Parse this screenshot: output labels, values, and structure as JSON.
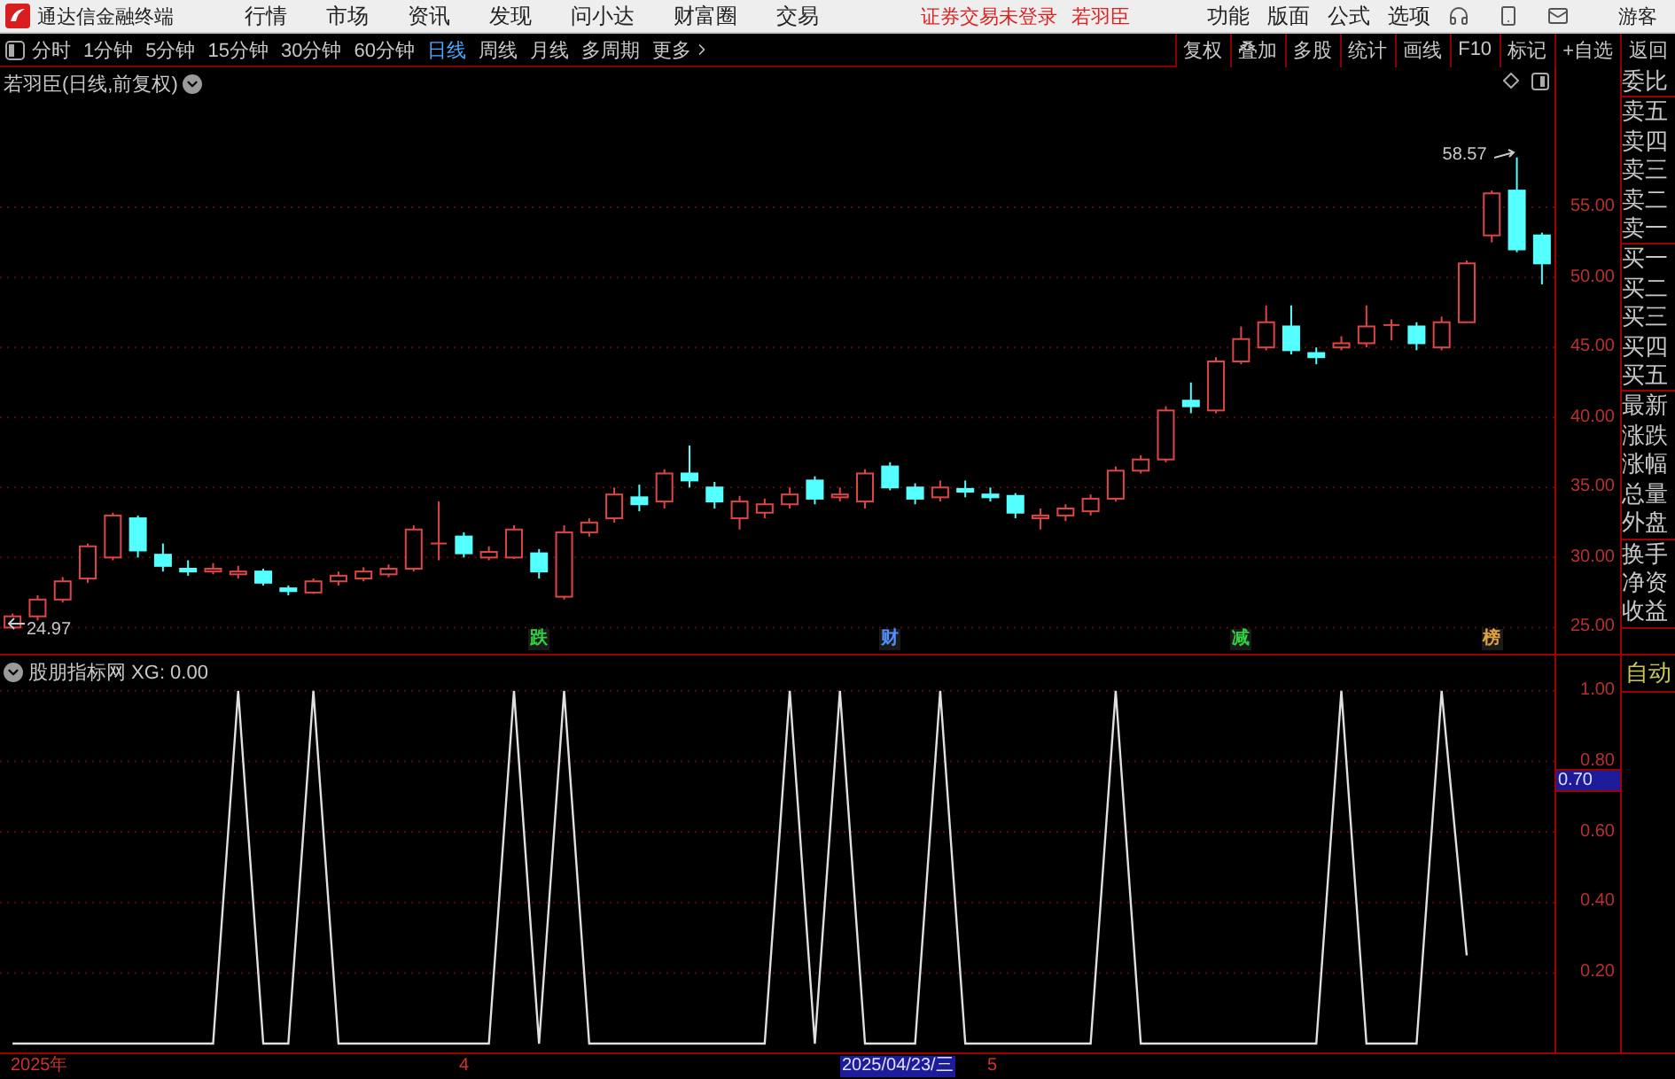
{
  "app": {
    "title": "通达信金融终端",
    "menu": [
      "行情",
      "市场",
      "资讯",
      "发现",
      "问小达",
      "财富圈",
      "交易"
    ],
    "login_status": "证券交易未登录",
    "stock": "若羽臣",
    "right_menu": [
      "功能",
      "版面",
      "公式",
      "选项"
    ],
    "user": "游客"
  },
  "toolbar": {
    "periods": [
      {
        "label": "分时",
        "selected": false
      },
      {
        "label": "1分钟",
        "selected": false
      },
      {
        "label": "5分钟",
        "selected": false
      },
      {
        "label": "15分钟",
        "selected": false
      },
      {
        "label": "30分钟",
        "selected": false
      },
      {
        "label": "60分钟",
        "selected": false
      },
      {
        "label": "日线",
        "selected": true
      },
      {
        "label": "周线",
        "selected": false
      },
      {
        "label": "月线",
        "selected": false
      },
      {
        "label": "多周期",
        "selected": false
      }
    ],
    "more": "更多",
    "actions": [
      "复权",
      "叠加",
      "多股",
      "统计",
      "画线",
      "F10",
      "标记",
      "+自选",
      "返回"
    ]
  },
  "price_chart": {
    "title": "若羽臣(日线,前复权)",
    "high_label": "58.57",
    "low_label": "24.97",
    "markers": [
      {
        "label": "跌",
        "color": "#30d040"
      },
      {
        "label": "财",
        "color": "#5090ff"
      },
      {
        "label": "减",
        "color": "#30d040"
      },
      {
        "label": "榜",
        "color": "#e0a040"
      }
    ],
    "chart_data": {
      "type": "candlestick",
      "ylim": [
        23,
        65
      ],
      "yticks": [
        {
          "value": 55,
          "label": "55.00"
        },
        {
          "value": 50,
          "label": "50.00"
        },
        {
          "value": 45,
          "label": "45.00"
        },
        {
          "value": 40,
          "label": "40.00"
        },
        {
          "value": 35,
          "label": "35.00"
        },
        {
          "value": 30,
          "label": "30.00"
        },
        {
          "value": 25,
          "label": "25.00"
        }
      ],
      "grid": true,
      "ohlc": [
        [
          25,
          26,
          24.97,
          25.8
        ],
        [
          25.8,
          27.3,
          25.5,
          27
        ],
        [
          27,
          28.6,
          26.8,
          28.3
        ],
        [
          28.5,
          31,
          28.2,
          30.8
        ],
        [
          30,
          33.2,
          29.8,
          33
        ],
        [
          32.8,
          33,
          30,
          30.5
        ],
        [
          30.2,
          31,
          29,
          29.4
        ],
        [
          29.2,
          29.8,
          28.7,
          29
        ],
        [
          29,
          29.6,
          28.8,
          29.2
        ],
        [
          28.8,
          29.4,
          28.5,
          29
        ],
        [
          29,
          29.2,
          28,
          28.2
        ],
        [
          27.8,
          28,
          27.3,
          27.6
        ],
        [
          27.5,
          28.5,
          27.4,
          28.3
        ],
        [
          28.3,
          29,
          28,
          28.7
        ],
        [
          28.5,
          29.3,
          28.3,
          29
        ],
        [
          28.8,
          29.5,
          28.6,
          29.2
        ],
        [
          29.2,
          32.3,
          29,
          32
        ],
        [
          31,
          34,
          29.8,
          31
        ],
        [
          31.5,
          31.8,
          30,
          30.3
        ],
        [
          30,
          30.8,
          29.8,
          30.4
        ],
        [
          30,
          32.3,
          29.9,
          32
        ],
        [
          30.3,
          30.6,
          28.5,
          29
        ],
        [
          27.2,
          32.3,
          27,
          31.8
        ],
        [
          31.8,
          32.8,
          31.5,
          32.5
        ],
        [
          32.8,
          35,
          32.5,
          34.5
        ],
        [
          34.3,
          35.2,
          33.3,
          33.8
        ],
        [
          34,
          36.3,
          33.5,
          36
        ],
        [
          36,
          38,
          35,
          35.5
        ],
        [
          35,
          35.4,
          33.5,
          34
        ],
        [
          32.8,
          34.4,
          32,
          34
        ],
        [
          33.2,
          34.2,
          32.8,
          33.8
        ],
        [
          33.8,
          35,
          33.5,
          34.5
        ],
        [
          35.5,
          35.8,
          33.8,
          34.2
        ],
        [
          34.3,
          35,
          34,
          34.5
        ],
        [
          34,
          36.3,
          33.5,
          36
        ],
        [
          36.5,
          36.8,
          34.8,
          35
        ],
        [
          35,
          35.3,
          33.8,
          34.2
        ],
        [
          34.3,
          35.5,
          34,
          35
        ],
        [
          34.9,
          35.5,
          34.3,
          34.7
        ],
        [
          34.5,
          35,
          34,
          34.3
        ],
        [
          34.4,
          34.6,
          32.8,
          33.2
        ],
        [
          32.8,
          33.5,
          32,
          33
        ],
        [
          33,
          33.8,
          32.6,
          33.5
        ],
        [
          33.3,
          34.5,
          33,
          34.2
        ],
        [
          34.2,
          36.5,
          34,
          36.2
        ],
        [
          36.2,
          37.3,
          36,
          37
        ],
        [
          37,
          40.8,
          36.8,
          40.5
        ],
        [
          41.2,
          42.5,
          40.3,
          40.8
        ],
        [
          40.5,
          44.3,
          40.3,
          44
        ],
        [
          44,
          46.5,
          43.8,
          45.6
        ],
        [
          45,
          48,
          44.8,
          46.8
        ],
        [
          46.5,
          48,
          44.5,
          44.8
        ],
        [
          44.6,
          45,
          43.8,
          44.3
        ],
        [
          45,
          45.8,
          44.8,
          45.3
        ],
        [
          45.3,
          48,
          45,
          46.5
        ],
        [
          46.6,
          47,
          45.5,
          46.6
        ],
        [
          46.5,
          46.8,
          44.8,
          45.3
        ],
        [
          45,
          47.2,
          44.8,
          46.8
        ],
        [
          46.8,
          51.2,
          46.8,
          51
        ],
        [
          53,
          56.2,
          52.5,
          56
        ],
        [
          56.2,
          58.57,
          51.8,
          52
        ],
        [
          53,
          53.2,
          49.5,
          51
        ]
      ]
    }
  },
  "quote_panel": {
    "groups": [
      {
        "items": [
          "委比"
        ]
      },
      {
        "items": [
          "卖五",
          "卖四",
          "卖三",
          "卖二",
          "卖一"
        ]
      },
      {
        "items": [
          "买一",
          "买二",
          "买三",
          "买四",
          "买五"
        ]
      },
      {
        "items": [
          "最新",
          "涨跌",
          "涨幅",
          "总量",
          "外盘"
        ]
      },
      {
        "items": [
          "换手",
          "净资",
          "收益"
        ]
      }
    ],
    "auto_button": "自动"
  },
  "indicator": {
    "title": "股朋指标网 XG: 0.00",
    "current_value": "0.70",
    "chart_data": {
      "type": "line",
      "ylim": [
        -0.03,
        1.1
      ],
      "grid": true,
      "yticks": [
        {
          "value": 1,
          "label": "1.00"
        },
        {
          "value": 0.8,
          "label": "0.80"
        },
        {
          "value": 0.6,
          "label": "0.60"
        },
        {
          "value": 0.4,
          "label": "0.40"
        },
        {
          "value": 0.2,
          "label": "0.20"
        }
      ],
      "series": [
        {
          "color": "#e0e0e0",
          "values": [
            0,
            0,
            0,
            0,
            0,
            0,
            0,
            0,
            0,
            1,
            0,
            0,
            1,
            0,
            0,
            0,
            0,
            0,
            0,
            0,
            1,
            0,
            1,
            0,
            0,
            0,
            0,
            0,
            0,
            0,
            0,
            1,
            0,
            1,
            0,
            0,
            0,
            1,
            0,
            0,
            0,
            0,
            0,
            0,
            1,
            0,
            0,
            0,
            0,
            0,
            0,
            0,
            0,
            1,
            0,
            0,
            0,
            1,
            0.25,
            null,
            null,
            null
          ]
        }
      ]
    }
  },
  "time_axis": [
    {
      "label": "2025年",
      "selected": false
    },
    {
      "label": "4",
      "selected": false
    },
    {
      "label": "2025/04/23/三",
      "selected": true
    },
    {
      "label": "5",
      "selected": false
    }
  ]
}
